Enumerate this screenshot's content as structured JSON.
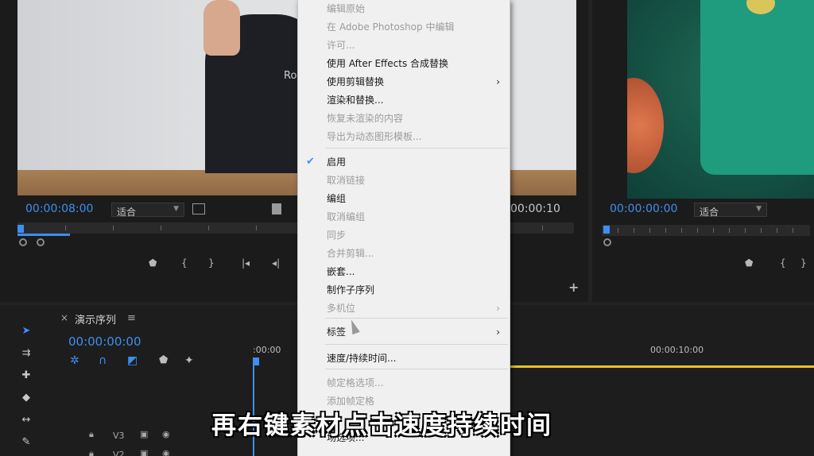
{
  "source_monitor": {
    "timecode": "00:00:08:00",
    "fit": "适合",
    "shirt_text": "Rom",
    "end_timecode": "00:00:10"
  },
  "program_monitor": {
    "timecode": "00:00:00:00",
    "fit": "适合",
    "plus": "+"
  },
  "timeline": {
    "sequence_name": "演示序列",
    "close": "×",
    "menu": "≡",
    "timecode": "00:00:00:00",
    "ruler_start": ":00:00",
    "ruler_mark": "00:00:10:00",
    "tracks": [
      {
        "label": "V3"
      },
      {
        "label": "V2"
      }
    ]
  },
  "context_menu": {
    "items": [
      {
        "label": "编辑原始",
        "enabled": false,
        "submenu": false,
        "checked": false
      },
      {
        "label": "在 Adobe Photoshop 中编辑",
        "enabled": false,
        "submenu": false,
        "checked": false
      },
      {
        "label": "许可...",
        "enabled": false,
        "submenu": false,
        "checked": false
      },
      {
        "label": "使用 After Effects 合成替换",
        "enabled": true,
        "submenu": false,
        "checked": false
      },
      {
        "label": "使用剪辑替换",
        "enabled": true,
        "submenu": true,
        "checked": false
      },
      {
        "label": "渲染和替换...",
        "enabled": true,
        "submenu": false,
        "checked": false
      },
      {
        "label": "恢复未渲染的内容",
        "enabled": false,
        "submenu": false,
        "checked": false
      },
      {
        "label": "导出为动态图形模板...",
        "enabled": false,
        "submenu": false,
        "checked": false
      },
      {
        "label": "启用",
        "enabled": true,
        "submenu": false,
        "checked": true
      },
      {
        "label": "取消链接",
        "enabled": false,
        "submenu": false,
        "checked": false
      },
      {
        "label": "编组",
        "enabled": true,
        "submenu": false,
        "checked": false
      },
      {
        "label": "取消编组",
        "enabled": false,
        "submenu": false,
        "checked": false
      },
      {
        "label": "同步",
        "enabled": false,
        "submenu": false,
        "checked": false
      },
      {
        "label": "合并剪辑...",
        "enabled": false,
        "submenu": false,
        "checked": false
      },
      {
        "label": "嵌套...",
        "enabled": true,
        "submenu": false,
        "checked": false
      },
      {
        "label": "制作子序列",
        "enabled": true,
        "submenu": false,
        "checked": false
      },
      {
        "label": "多机位",
        "enabled": false,
        "submenu": true,
        "checked": false
      },
      {
        "label": "标签",
        "enabled": true,
        "submenu": true,
        "checked": false
      },
      {
        "label": "速度/持续时间...",
        "enabled": true,
        "submenu": false,
        "checked": false
      },
      {
        "label": "帧定格选项...",
        "enabled": false,
        "submenu": false,
        "checked": false
      },
      {
        "label": "添加帧定格",
        "enabled": false,
        "submenu": false,
        "checked": false
      },
      {
        "label": "场选项...",
        "enabled": true,
        "submenu": false,
        "checked": false
      }
    ]
  },
  "caption": "再右键素材点击速度持续时间",
  "colors": {
    "accent": "#3d8ff0",
    "yellow": "#e8c21d",
    "menu_bg": "#f0f0f0"
  }
}
